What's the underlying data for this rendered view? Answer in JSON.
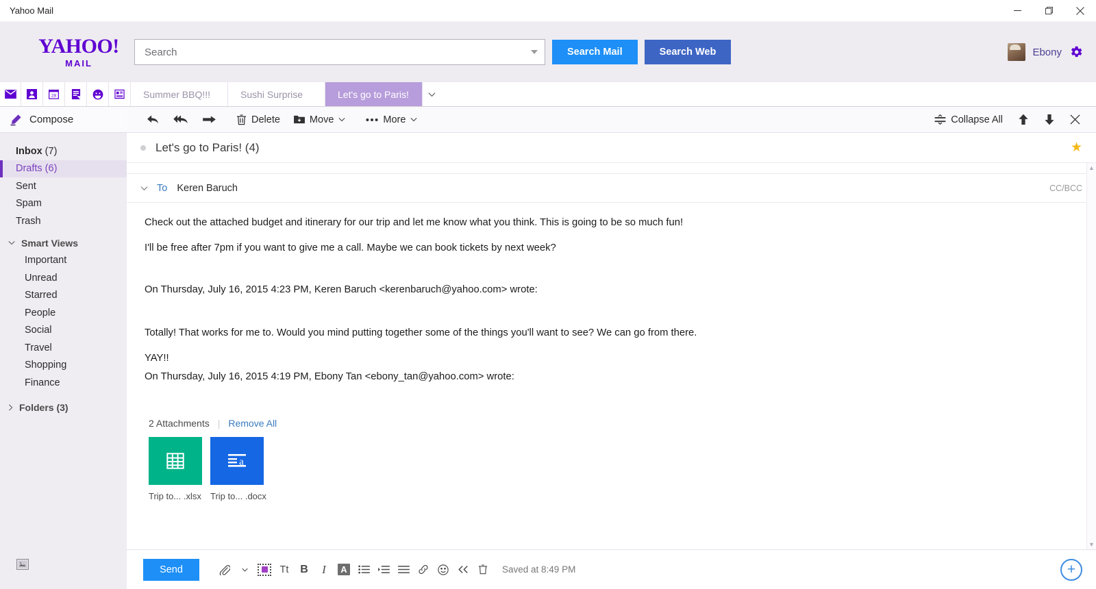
{
  "window": {
    "title": "Yahoo Mail",
    "minimize_label": "Minimize",
    "maximize_label": "Restore",
    "close_label": "Close"
  },
  "header": {
    "logo_primary": "YAHOO!",
    "logo_secondary": "MAIL",
    "search_placeholder": "Search",
    "search_value": "",
    "search_mail_label": "Search Mail",
    "search_web_label": "Search Web",
    "user_name": "Ebony",
    "settings_label": "Settings"
  },
  "app_icons": [
    {
      "name": "mail-icon",
      "label": "Mail"
    },
    {
      "name": "contacts-icon",
      "label": "Contacts"
    },
    {
      "name": "calendar-icon",
      "label": "Calendar",
      "day": "28"
    },
    {
      "name": "notepad-icon",
      "label": "Notepad"
    },
    {
      "name": "messenger-icon",
      "label": "Messenger"
    },
    {
      "name": "news-icon",
      "label": "News Feed"
    }
  ],
  "mail_tabs": [
    {
      "label": "Summer BBQ!!!",
      "active": false
    },
    {
      "label": "Sushi Surprise",
      "active": false
    },
    {
      "label": "Let's go to Paris!",
      "active": true
    }
  ],
  "sidebar": {
    "compose_label": "Compose",
    "folders": [
      {
        "label": "Inbox",
        "count": "(7)",
        "bold": true,
        "selected": false
      },
      {
        "label": "Drafts",
        "count": "(6)",
        "bold": false,
        "selected": true
      },
      {
        "label": "Sent",
        "count": "",
        "bold": false,
        "selected": false
      },
      {
        "label": "Spam",
        "count": "",
        "bold": false,
        "selected": false
      },
      {
        "label": "Trash",
        "count": "",
        "bold": false,
        "selected": false
      }
    ],
    "smart_views_label": "Smart Views",
    "smart_views": [
      {
        "label": "Important"
      },
      {
        "label": "Unread"
      },
      {
        "label": "Starred"
      },
      {
        "label": "People"
      },
      {
        "label": "Social"
      },
      {
        "label": "Travel"
      },
      {
        "label": "Shopping"
      },
      {
        "label": "Finance"
      }
    ],
    "folders_group_label": "Folders (3)"
  },
  "toolbar": {
    "reply_label": "Reply",
    "reply_all_label": "Reply All",
    "forward_label": "Forward",
    "delete_label": "Delete",
    "move_label": "Move",
    "more_label": "More",
    "collapse_all_label": "Collapse All",
    "prev_label": "Previous message",
    "next_label": "Next message",
    "close_label": "Close"
  },
  "message": {
    "subject": "Let's go to Paris! (4)",
    "starred": true,
    "to_label": "To",
    "to_recipient": "Keren Baruch",
    "ccbcc_label": "CC/BCC",
    "paragraphs": [
      "Check out the attached budget and itinerary for our trip and let me know what you think. This is going to be so much fun!",
      "I'll be free after 7pm if you want to give me a call. Maybe we can book tickets by next week?"
    ],
    "quote_header_1": "On Thursday, July 16, 2015 4:23 PM, Keren Baruch <kerenbaruch@yahoo.com> wrote:",
    "quote_body_1": "Totally! That works for me to. Would you mind putting together some of the things you'll want to see? We can go from there.",
    "quote_exclaim": "YAY!!",
    "quote_header_2": "On Thursday, July 16, 2015 4:19 PM, Ebony Tan <ebony_tan@yahoo.com> wrote:"
  },
  "attachments": {
    "count_label": "2 Attachments",
    "remove_all_label": "Remove All",
    "items": [
      {
        "name": "Trip to...",
        "ext": ".xlsx",
        "icon": "spreadsheet-icon",
        "color": "#00b388"
      },
      {
        "name": "Trip to...",
        "ext": ".docx",
        "icon": "document-icon",
        "color": "#1567e3"
      }
    ]
  },
  "compose_footer": {
    "send_label": "Send",
    "saved_label": "Saved at 8:49 PM",
    "tools": [
      {
        "name": "attach-icon",
        "label": "Attach files"
      },
      {
        "name": "attach-dropdown-icon",
        "label": "Attach options"
      },
      {
        "name": "stamp-icon",
        "label": "Stationery"
      },
      {
        "name": "font-size-icon",
        "label": "Font",
        "glyph": "Tt"
      },
      {
        "name": "bold-icon",
        "label": "Bold",
        "glyph": "B"
      },
      {
        "name": "italic-icon",
        "label": "Italic",
        "glyph": "I"
      },
      {
        "name": "text-color-icon",
        "label": "Text color",
        "glyph": "A"
      },
      {
        "name": "bullet-list-icon",
        "label": "Bulleted list"
      },
      {
        "name": "indent-icon",
        "label": "Indent"
      },
      {
        "name": "align-icon",
        "label": "Align"
      },
      {
        "name": "link-icon",
        "label": "Insert link"
      },
      {
        "name": "emoji-icon",
        "label": "Insert emoji"
      },
      {
        "name": "collapse-toolbar-icon",
        "label": "Collapse toolbar"
      },
      {
        "name": "discard-icon",
        "label": "Discard draft"
      }
    ],
    "new_compose_label": "New message"
  },
  "colors": {
    "yahoo_purple": "#5f01d1",
    "tab_active": "#b79ddb",
    "search_mail_blue": "#1d8ff7",
    "search_web_blue": "#3d65c4",
    "star_gold": "#f5b919",
    "xlsx_green": "#00b388",
    "docx_blue": "#1567e3"
  }
}
